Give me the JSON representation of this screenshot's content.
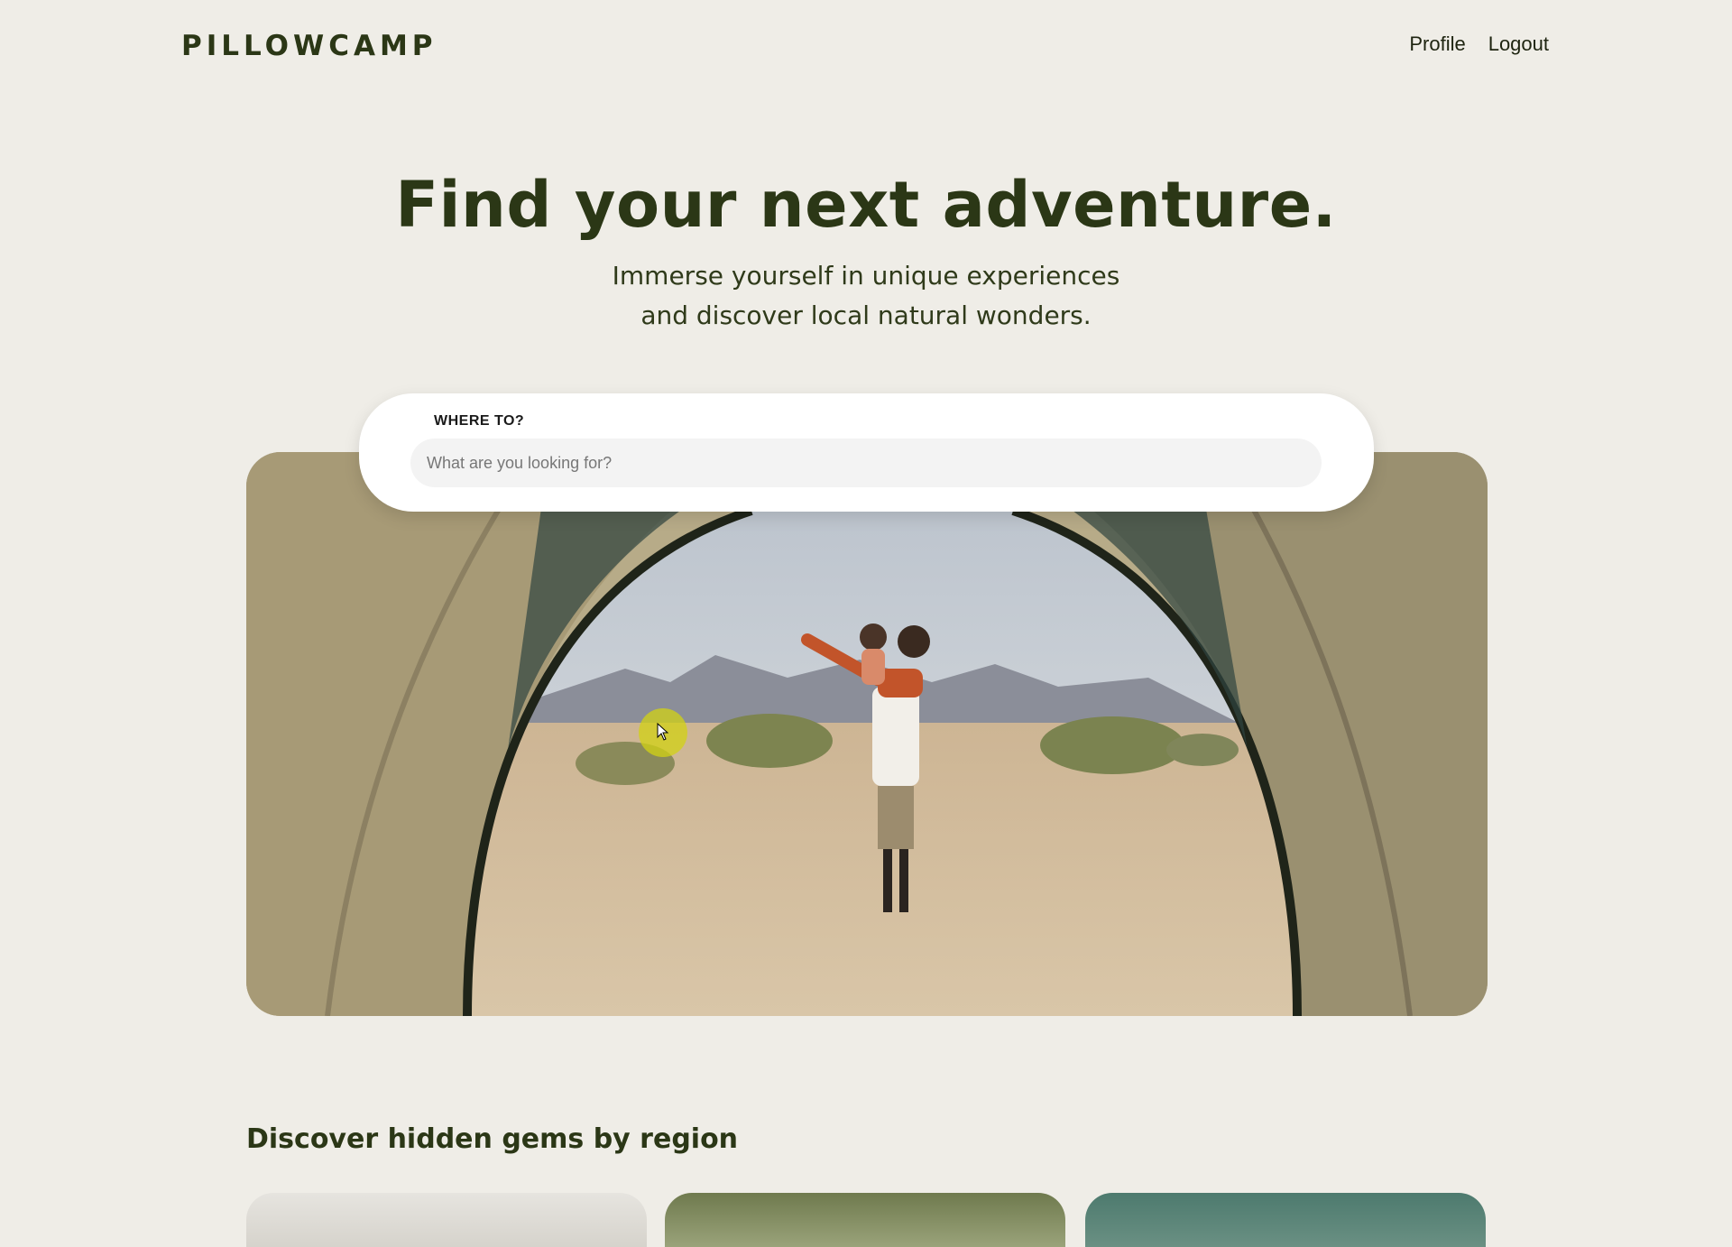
{
  "header": {
    "logo": "PILLOWCAMP",
    "nav": [
      "Profile",
      "Logout"
    ]
  },
  "hero": {
    "title": "Find your next adventure.",
    "subtitle_lines": [
      "Immerse yourself in unique experiences",
      "and discover local natural wonders."
    ]
  },
  "search": {
    "label": "WHERE TO?",
    "placeholder": "What are you looking for?",
    "value": ""
  },
  "sections": {
    "regions_title": "Discover hidden gems by region"
  },
  "colors": {
    "background": "#efede7",
    "brand_dark_green": "#2b3716",
    "cursor_highlight": "#d2d214"
  }
}
